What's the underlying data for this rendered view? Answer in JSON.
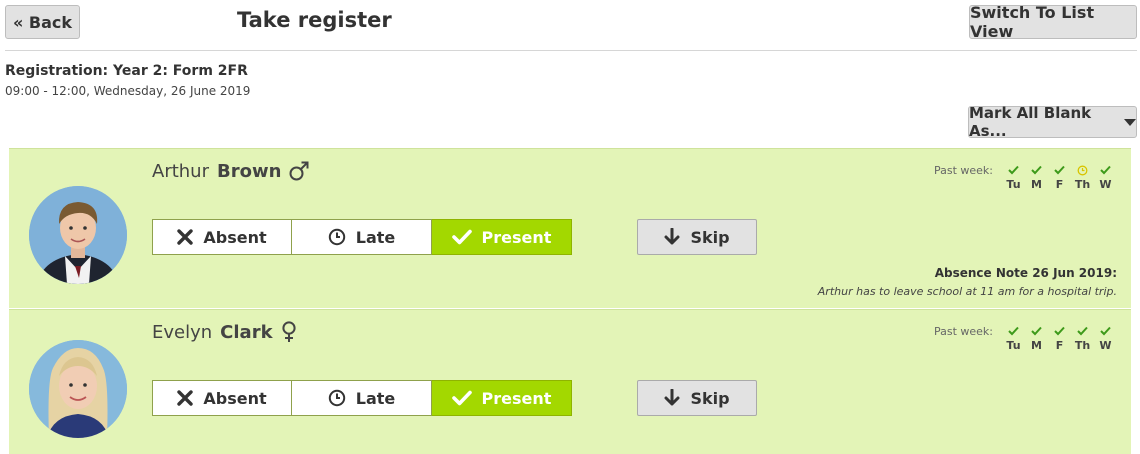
{
  "header": {
    "back_label": "« Back",
    "title": "Take register",
    "switch_label": "Switch To List View"
  },
  "registration": {
    "title": "Registration: Year 2: Form 2FR",
    "time": "09:00 - 12:00, Wednesday, 26 June 2019"
  },
  "mark_all_label": "Mark All Blank As...",
  "options": {
    "absent": "Absent",
    "late": "Late",
    "present": "Present",
    "skip": "Skip"
  },
  "past_week_label": "Past week:",
  "colors": {
    "row_bg": "#e3f4b7",
    "present_active": "#a3d800",
    "check_green": "#3d9a1a",
    "late_yellow": "#d8c400"
  },
  "students": [
    {
      "first_name": "Arthur",
      "last_name": "Brown",
      "gender_icon": "male-symbol-icon",
      "selected": "Present",
      "past_week": [
        {
          "day": "Tu",
          "mark": "present"
        },
        {
          "day": "M",
          "mark": "present"
        },
        {
          "day": "F",
          "mark": "present"
        },
        {
          "day": "Th",
          "mark": "late"
        },
        {
          "day": "W",
          "mark": "present"
        }
      ],
      "absence_note_title": "Absence Note 26 Jun 2019:",
      "absence_note_text": "Arthur has to leave school at 11 am for a hospital trip."
    },
    {
      "first_name": "Evelyn",
      "last_name": "Clark",
      "gender_icon": "female-symbol-icon",
      "selected": "Present",
      "past_week": [
        {
          "day": "Tu",
          "mark": "present"
        },
        {
          "day": "M",
          "mark": "present"
        },
        {
          "day": "F",
          "mark": "present"
        },
        {
          "day": "Th",
          "mark": "present"
        },
        {
          "day": "W",
          "mark": "present"
        }
      ]
    }
  ]
}
